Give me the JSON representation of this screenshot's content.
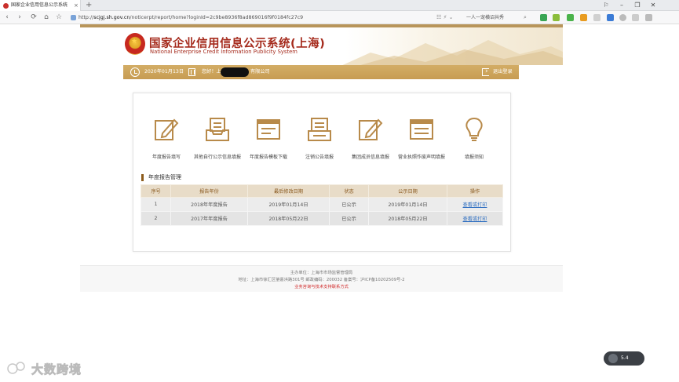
{
  "browser": {
    "tab_title": "国家企业信用信息公示系统",
    "tab_close": "×",
    "new_tab": "+",
    "url_prefix": "http://",
    "url_host": "scjgj.sh.gov.cn",
    "url_path": "/noticerpt/report/home?loginId=2c9be8936f8ad869016f9f0184fc27c9",
    "search_text": "一人一宠横诏共秀",
    "win_controls": [
      "⚐",
      "–",
      "❐",
      "✕"
    ],
    "nav": {
      "back": "‹",
      "forward": "›",
      "home": "⌂",
      "star": "☆"
    },
    "url_tools": "☷ ⚡ ⌄"
  },
  "site": {
    "title": "国家企业信用信息公示系统(上海)",
    "subtitle": "National Enterprise Credit Information Publicity System"
  },
  "infobar": {
    "date": "2020年01月13日",
    "greeting_prefix": "您好！上",
    "greeting_suffix": "有限公司",
    "logout": "退出登录"
  },
  "functions": [
    {
      "label": "年度报告填写",
      "icon": "edit-form-icon"
    },
    {
      "label": "其他自行公示信息填报",
      "icon": "document-tray-icon"
    },
    {
      "label": "年度报告模板下载",
      "icon": "template-download-icon"
    },
    {
      "label": "注销公告填报",
      "icon": "cancel-notice-icon"
    },
    {
      "label": "集团成员信息填报",
      "icon": "group-member-icon"
    },
    {
      "label": "营业执照作废声明填报",
      "icon": "license-void-icon"
    },
    {
      "label": "填报须知",
      "icon": "lightbulb-icon"
    }
  ],
  "report_section": {
    "title": "年度报告管理",
    "columns": [
      "序号",
      "报告年份",
      "最后修改日期",
      "状态",
      "公示日期",
      "操作"
    ],
    "rows": [
      {
        "no": "1",
        "year": "2018年年度报告",
        "modified": "2019年01月14日",
        "status": "已公示",
        "published": "2019年01月14日",
        "action": "查看或打印"
      },
      {
        "no": "2",
        "year": "2017年年度报告",
        "modified": "2018年05月22日",
        "status": "已公示",
        "published": "2018年05月22日",
        "action": "查看或打印"
      }
    ]
  },
  "footer": {
    "sponsor": "主办单位：上海市市场监督管理局",
    "address": "地址：上海市徐汇区肇嘉浜路301号 邮政编码：200032 备案号：沪ICP备10202509号-2",
    "support": "业务咨询与技术支持联系方式"
  },
  "watermark": {
    "text": "大数跨境"
  },
  "float_button": {
    "label": "5.4"
  },
  "colors": {
    "gold": "#c79c52",
    "brand_red": "#a52a1c",
    "header_brown": "#8a5a20",
    "link_blue": "#2f6fc1"
  }
}
